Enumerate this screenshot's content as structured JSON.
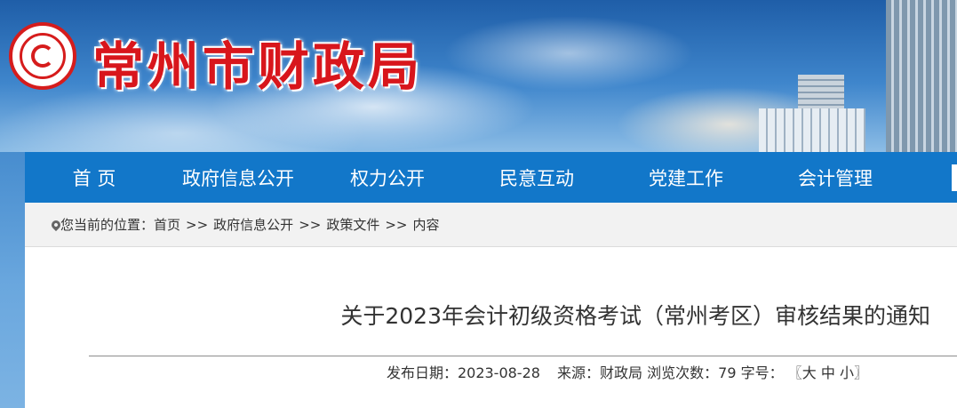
{
  "header": {
    "site_title": "常州市财政局"
  },
  "nav": {
    "items": [
      {
        "label": "首 页"
      },
      {
        "label": "政府信息公开"
      },
      {
        "label": "权力公开"
      },
      {
        "label": "民意互动"
      },
      {
        "label": "党建工作"
      },
      {
        "label": "会计管理"
      }
    ]
  },
  "breadcrumb": {
    "prefix": "您当前的位置：",
    "items": [
      "首页",
      "政府信息公开",
      "政策文件",
      "内容"
    ],
    "separator": ">>"
  },
  "article": {
    "title": "关于2023年会计初级资格考试（常州考区）审核结果的通知",
    "publish_label": "发布日期：",
    "publish_date": "2023-08-28",
    "source_label": "来源：",
    "source": "财政局",
    "views_label": "浏览次数：",
    "views": "79",
    "fontsize_label": "字号：",
    "fontsize_open": "〖",
    "fontsize_large": "大",
    "fontsize_medium": "中",
    "fontsize_small": "小",
    "fontsize_close": "〗"
  },
  "colors": {
    "nav_bg": "#1277c9",
    "title_red": "#d8161c"
  }
}
